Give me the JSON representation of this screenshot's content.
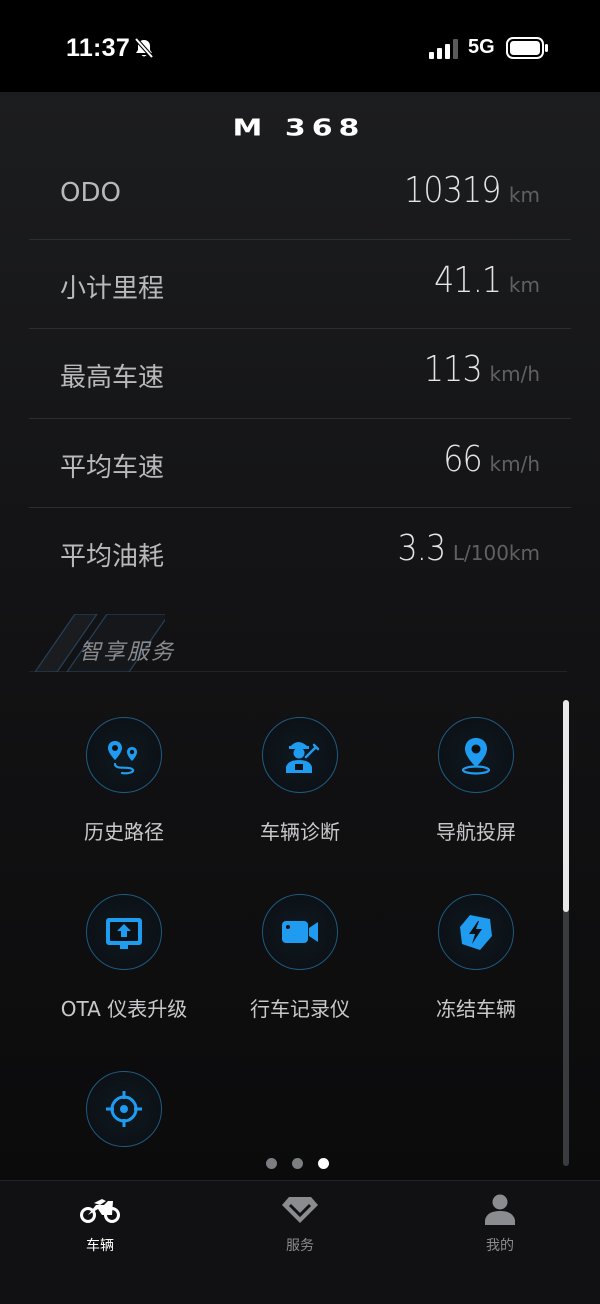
{
  "status_bar": {
    "time": "11:37",
    "network": "5G"
  },
  "header": {
    "logo_text": "M 368"
  },
  "stats": [
    {
      "label": "ODO",
      "value": "10319",
      "unit": "km"
    },
    {
      "label": "小计里程",
      "value": "41.1",
      "unit": "km"
    },
    {
      "label": "最高车速",
      "value": "113",
      "unit": "km/h"
    },
    {
      "label": "平均车速",
      "value": "66",
      "unit": "km/h"
    },
    {
      "label": "平均油耗",
      "value": "3.3",
      "unit": "L/100km"
    }
  ],
  "services": {
    "title": "智享服务",
    "items": [
      {
        "label": "历史路径",
        "icon": "route-icon"
      },
      {
        "label": "车辆诊断",
        "icon": "mechanic-icon"
      },
      {
        "label": "导航投屏",
        "icon": "location-pin-icon"
      },
      {
        "label": "OTA 仪表升级",
        "icon": "ota-upgrade-icon"
      },
      {
        "label": "行车记录仪",
        "icon": "video-camera-icon"
      },
      {
        "label": "冻结车辆",
        "icon": "lightning-shield-icon"
      },
      {
        "label": "",
        "icon": "crosshair-icon"
      }
    ]
  },
  "pager": {
    "total": 3,
    "active_index": 2
  },
  "tab_bar": {
    "tabs": [
      {
        "label": "车辆",
        "icon": "motorcycle-icon",
        "active": true
      },
      {
        "label": "服务",
        "icon": "diamond-icon",
        "active": false
      },
      {
        "label": "我的",
        "icon": "person-icon",
        "active": false
      }
    ]
  },
  "colors": {
    "accent": "#1f9cf0",
    "background": "#0b0b0c",
    "circle_border": "#1e5a80"
  }
}
